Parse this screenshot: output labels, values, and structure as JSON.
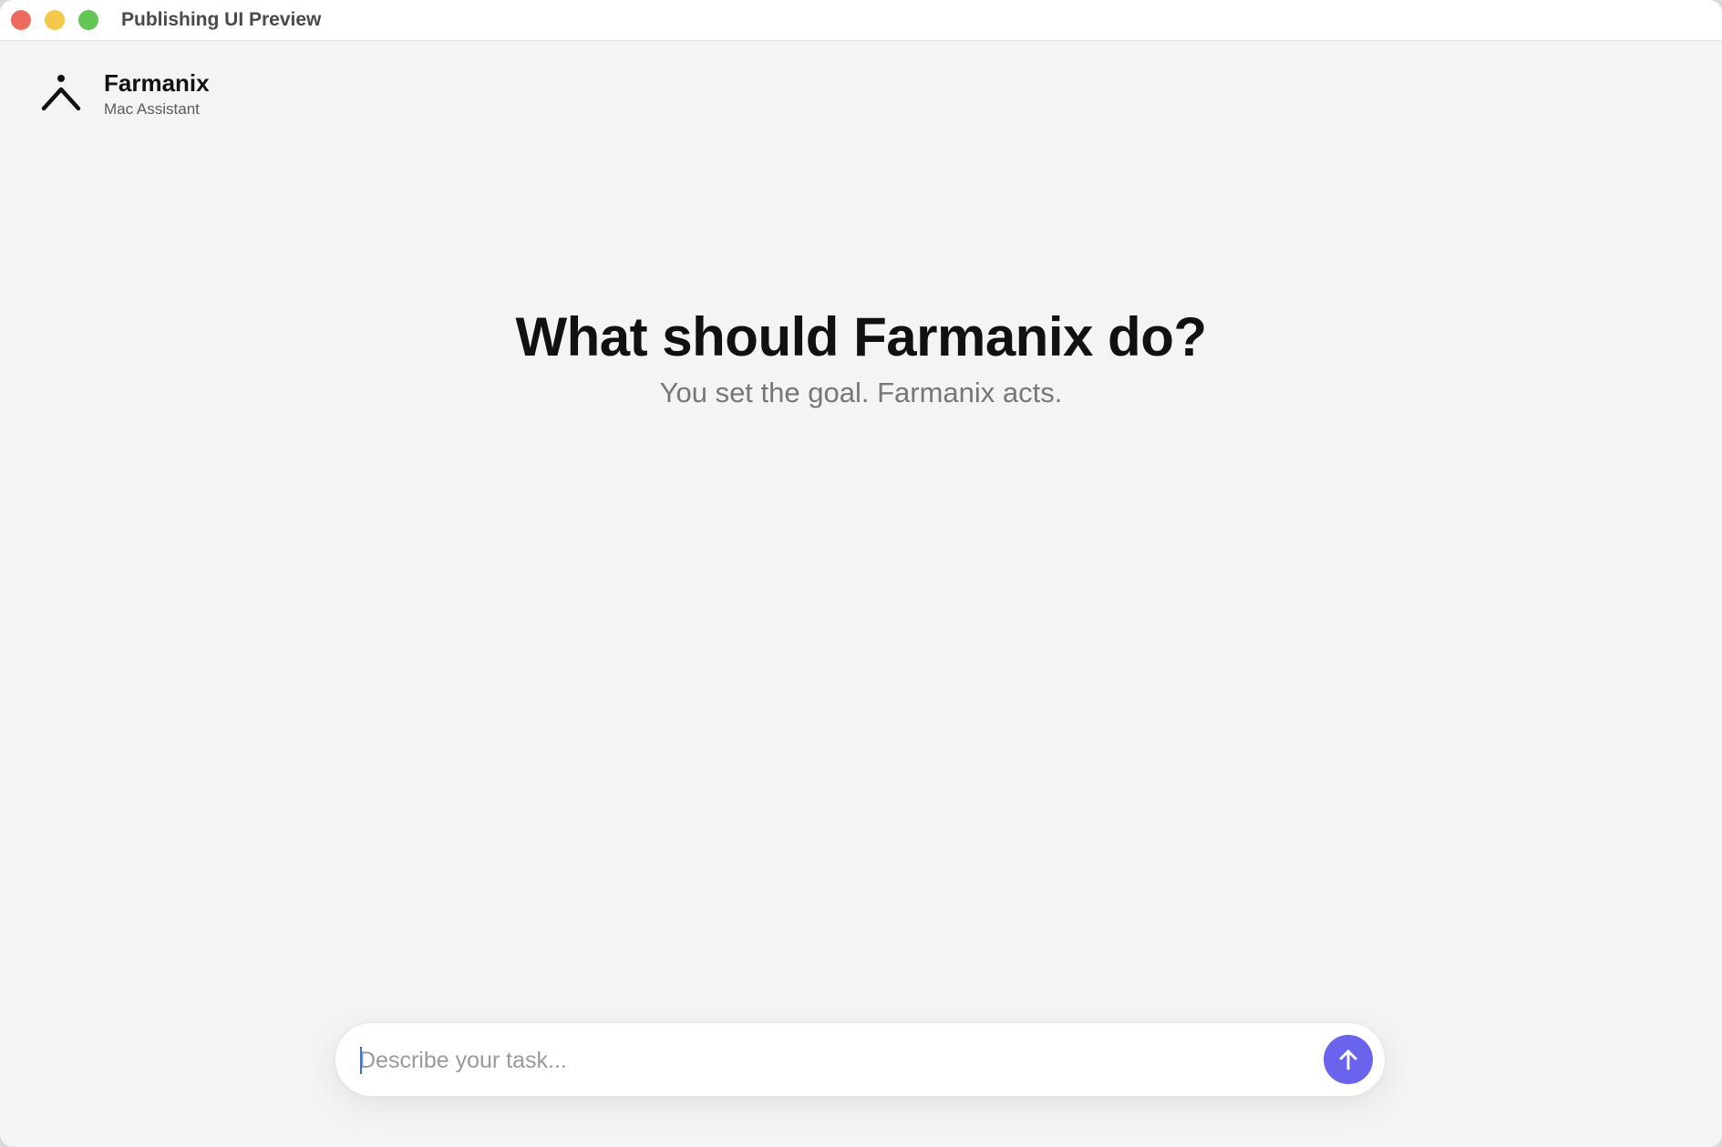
{
  "window": {
    "title": "Publishing UI Preview",
    "controls": {
      "close_color": "#ed6a5e",
      "minimize_color": "#f4c84a",
      "zoom_color": "#62c554"
    }
  },
  "brand": {
    "name": "Farmanix",
    "subtitle": "Mac Assistant",
    "logo_icon": "person-caret-icon"
  },
  "hero": {
    "title": "What should Farmanix do?",
    "subtitle": "You set the goal. Farmanix acts."
  },
  "composer": {
    "value": "",
    "placeholder": "Describe your task...",
    "send_icon": "arrow-up-icon",
    "send_color": "#6a63ee"
  }
}
